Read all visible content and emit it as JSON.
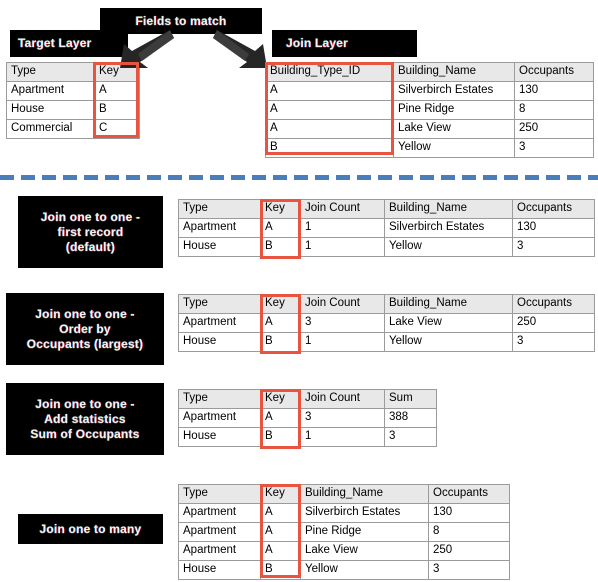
{
  "diagram": {
    "title_banner": "Fields to match",
    "target_layer_label": "Target Layer",
    "join_layer_label": "Join Layer"
  },
  "target_table": {
    "headers": [
      "Type",
      "Key"
    ],
    "rows": [
      [
        "Apartment",
        "A"
      ],
      [
        "House",
        "B"
      ],
      [
        "Commercial",
        "C"
      ]
    ]
  },
  "join_table": {
    "headers": [
      "Building_Type_ID",
      "Building_Name",
      "Occupants"
    ],
    "rows": [
      [
        "A",
        "Silverbirch Estates",
        "130"
      ],
      [
        "A",
        "Pine Ridge",
        "8"
      ],
      [
        "A",
        "Lake View",
        "250"
      ],
      [
        "B",
        "Yellow",
        "3"
      ]
    ]
  },
  "results": [
    {
      "caption_lines": [
        "Join one to one -",
        "first record",
        "(default)"
      ],
      "headers": [
        "Type",
        "Key",
        "Join Count",
        "Building_Name",
        "Occupants"
      ],
      "rows": [
        [
          "Apartment",
          "A",
          "1",
          "Silverbirch Estates",
          "130"
        ],
        [
          "House",
          "B",
          "1",
          "Yellow",
          "3"
        ]
      ]
    },
    {
      "caption_lines": [
        "Join one to one -",
        "Order by",
        "Occupants (largest)"
      ],
      "headers": [
        "Type",
        "Key",
        "Join Count",
        "Building_Name",
        "Occupants"
      ],
      "rows": [
        [
          "Apartment",
          "A",
          "3",
          "Lake View",
          "250"
        ],
        [
          "House",
          "B",
          "1",
          "Yellow",
          "3"
        ]
      ]
    },
    {
      "caption_lines": [
        "Join one to one -",
        "Add statistics",
        "Sum of Occupants"
      ],
      "headers": [
        "Type",
        "Key",
        "Join Count",
        "Sum"
      ],
      "rows": [
        [
          "Apartment",
          "A",
          "3",
          "388"
        ],
        [
          "House",
          "B",
          "1",
          "3"
        ]
      ]
    },
    {
      "caption_lines": [
        "Join one to many"
      ],
      "headers": [
        "Type",
        "Key",
        "Building_Name",
        "Occupants"
      ],
      "rows": [
        [
          "Apartment",
          "A",
          "Silverbirch Estates",
          "130"
        ],
        [
          "Apartment",
          "A",
          "Pine Ridge",
          "8"
        ],
        [
          "Apartment",
          "A",
          "Lake View",
          "250"
        ],
        [
          "House",
          "B",
          "Yellow",
          "3"
        ]
      ]
    }
  ],
  "colors": {
    "highlight": "#e8543f",
    "divider": "#4a7ebb",
    "header_bg": "#e8e8e8",
    "caption_bg": "#000000"
  }
}
